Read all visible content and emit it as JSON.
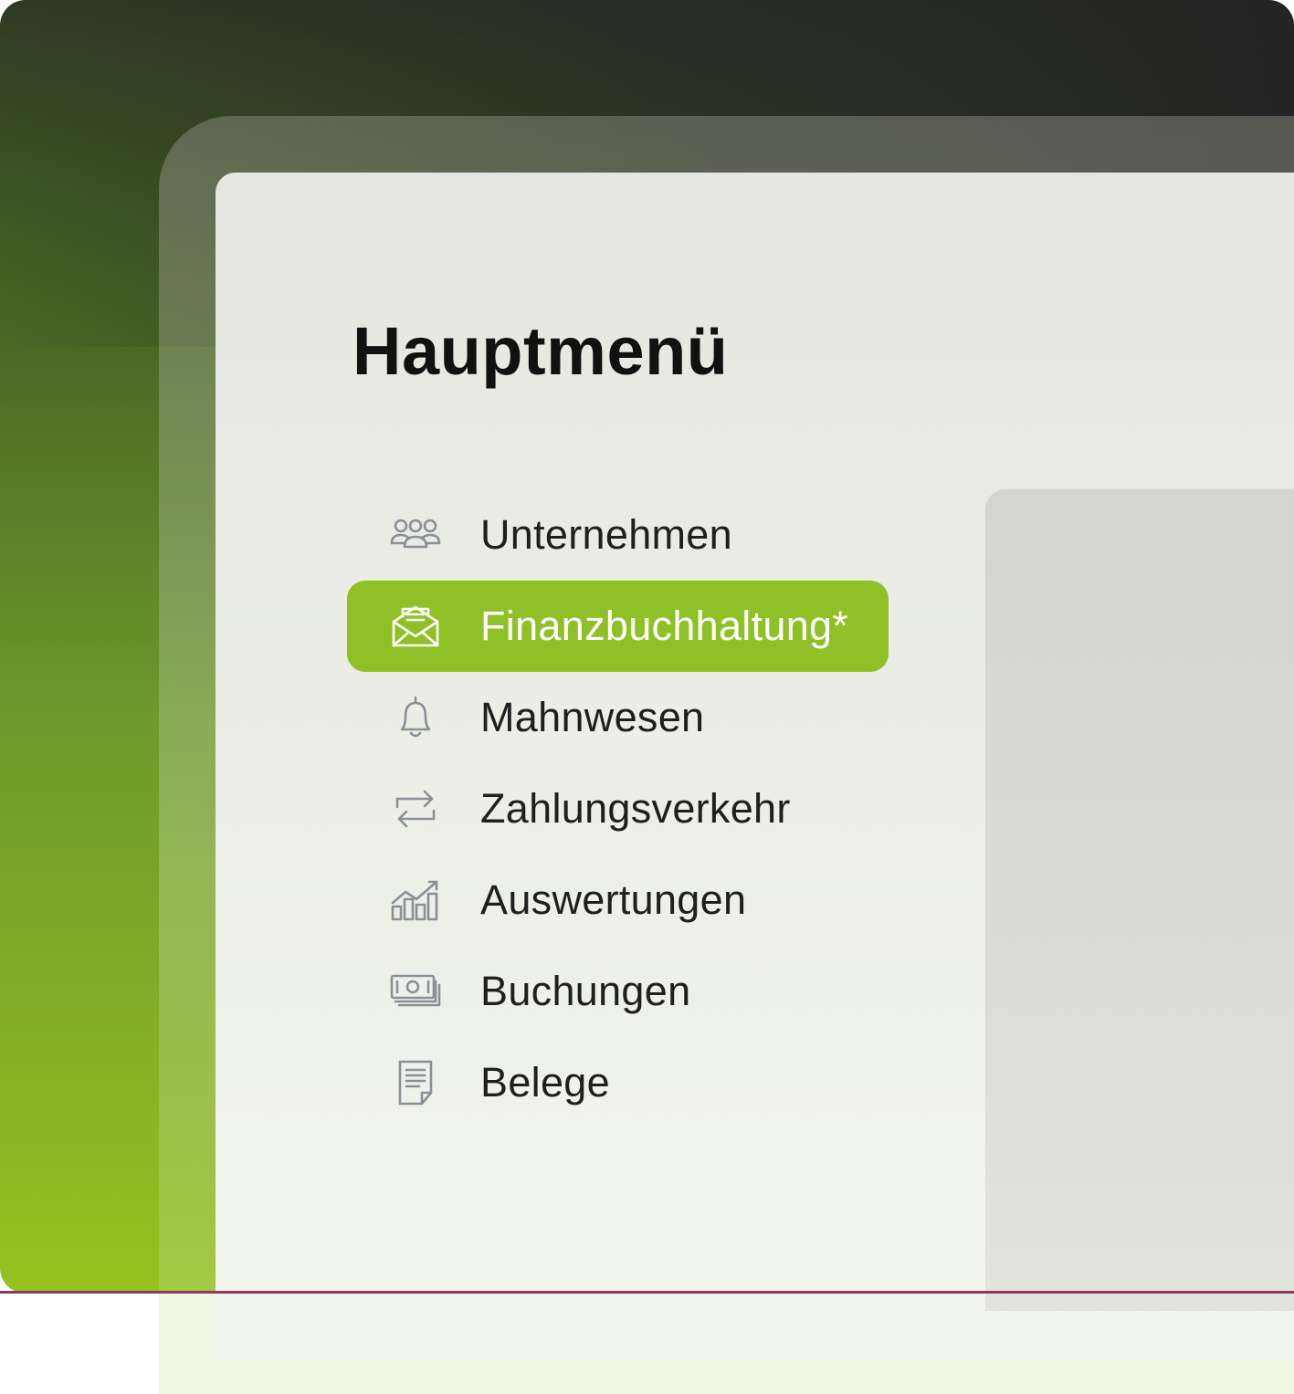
{
  "main_menu": {
    "title": "Hauptmenü",
    "items": [
      {
        "label": "Unternehmen",
        "icon": "users-group-icon",
        "active": false
      },
      {
        "label": "Finanzbuchhaltung*",
        "icon": "envelope-open-icon",
        "active": true
      },
      {
        "label": "Mahnwesen",
        "icon": "bell-icon",
        "active": false
      },
      {
        "label": "Zahlungsverkehr",
        "icon": "arrows-exchange-icon",
        "active": false
      },
      {
        "label": "Auswertungen",
        "icon": "chart-trend-icon",
        "active": false
      },
      {
        "label": "Buchungen",
        "icon": "banknotes-icon",
        "active": false
      },
      {
        "label": "Belege",
        "icon": "document-icon",
        "active": false
      }
    ]
  },
  "colors": {
    "accent": "#8fc127",
    "icon_gray": "#8a8f98",
    "text": "#1f1f1f"
  }
}
